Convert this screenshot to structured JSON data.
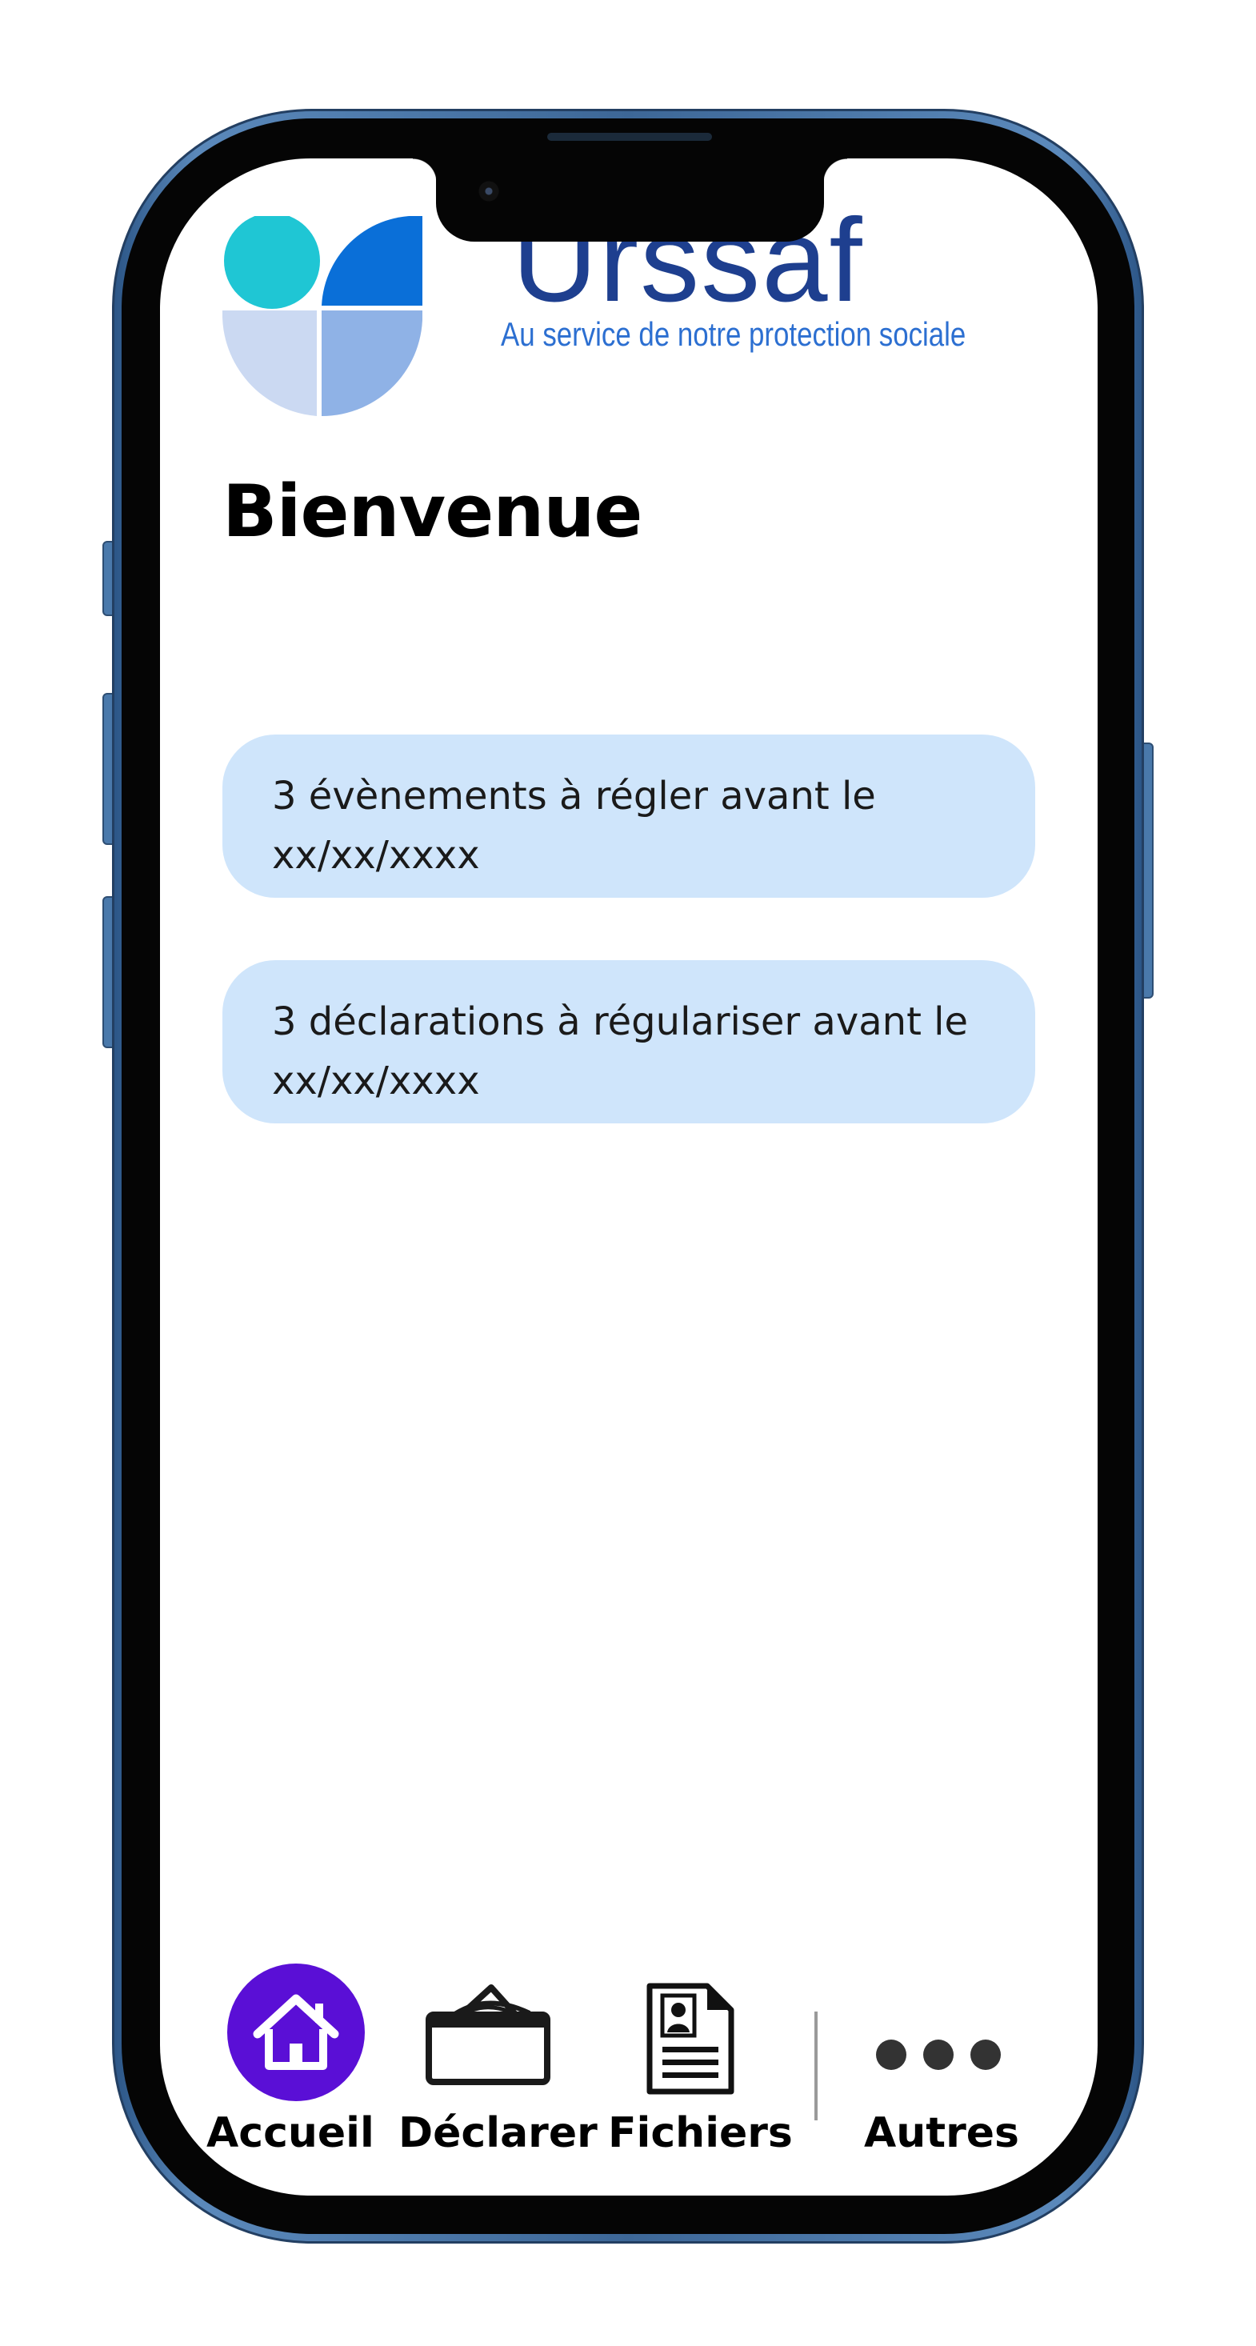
{
  "brand": {
    "name": "Urssaf",
    "tagline": "Au service de notre protection sociale",
    "colors": {
      "cyan": "#1fc6d4",
      "blue": "#0a6fd8",
      "light_blue": "#8fb2e6",
      "pale_blue": "#cbd9f2",
      "text_blue": "#1e3f8f"
    }
  },
  "page": {
    "title": "Bienvenue"
  },
  "alerts": [
    {
      "text_line1": "3 évènements à régler avant le",
      "text_line2": "xx/xx/xxxx"
    },
    {
      "text_line1": "3 déclarations à régulariser avant le",
      "text_line2": "xx/xx/xxxx"
    }
  ],
  "nav": {
    "items": [
      {
        "label": "Accueil",
        "icon": "home-icon",
        "active": true
      },
      {
        "label": "Déclarer",
        "icon": "envelope-declare-icon",
        "active": false
      },
      {
        "label": "Fichiers",
        "icon": "document-icon",
        "active": false
      },
      {
        "label": "Autres",
        "icon": "more-icon",
        "active": false
      }
    ],
    "active_color": "#5a0fd6"
  }
}
